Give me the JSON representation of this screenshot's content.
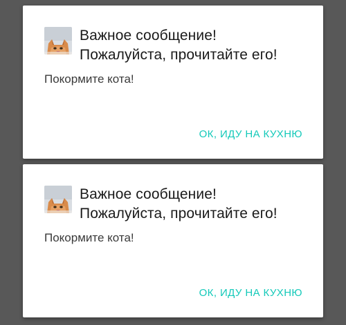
{
  "background_color": "#585858",
  "accent_color": "#13c9b9",
  "dialogs": [
    {
      "title_line1": "Важное сообщение!",
      "title_line2": "Пожалуйста, прочитайте его!",
      "message": "Покормите кота!",
      "action_label": "ОК, ИДУ НА КУХНЮ",
      "icon": "cat-photo-icon"
    },
    {
      "title_line1": "Важное сообщение!",
      "title_line2": "Пожалуйста, прочитайте его!",
      "message": "Покормите кота!",
      "action_label": "ОК, ИДУ НА КУХНЮ",
      "icon": "cat-photo-icon"
    }
  ]
}
